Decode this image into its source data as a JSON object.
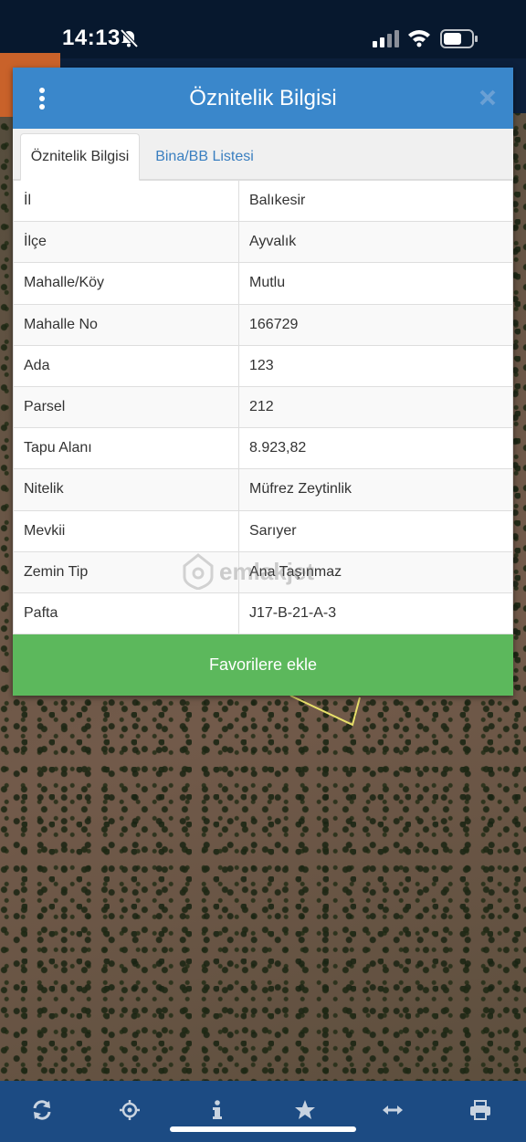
{
  "status_bar": {
    "time": "14:13",
    "icons": [
      "bell-slash-icon",
      "signal-icon",
      "wifi-icon",
      "battery-icon"
    ]
  },
  "dialog": {
    "title": "Öznitelik Bilgisi",
    "menu_icon": "kebab-menu-icon",
    "close_icon": "close-icon",
    "tabs": [
      {
        "label": "Öznitelik Bilgisi",
        "active": true
      },
      {
        "label": "Bina/BB Listesi",
        "active": false
      }
    ],
    "rows": [
      {
        "key": "İl",
        "value": "Balıkesir"
      },
      {
        "key": "İlçe",
        "value": "Ayvalık"
      },
      {
        "key": "Mahalle/Köy",
        "value": "Mutlu"
      },
      {
        "key": "Mahalle No",
        "value": "166729"
      },
      {
        "key": "Ada",
        "value": "123"
      },
      {
        "key": "Parsel",
        "value": "212"
      },
      {
        "key": "Tapu Alanı",
        "value": "8.923,82"
      },
      {
        "key": "Nitelik",
        "value": "Müfrez Zeytinlik"
      },
      {
        "key": "Mevkii",
        "value": "Sarıyer"
      },
      {
        "key": "Zemin Tip",
        "value": "Ana Taşınmaz"
      },
      {
        "key": "Pafta",
        "value": "J17-B-21-A-3"
      }
    ],
    "favorite_button": "Favorilere ekle"
  },
  "watermark": "emlakjet",
  "bottom_bar": {
    "icons": [
      "refresh-icon",
      "locate-icon",
      "info-icon",
      "star-icon",
      "measure-icon",
      "print-icon"
    ]
  },
  "colors": {
    "header_blue": "#3a87cb",
    "button_green": "#5cb85c",
    "bottom_bar_blue": "#1c4b83",
    "tab_link_blue": "#3a7fc0"
  }
}
